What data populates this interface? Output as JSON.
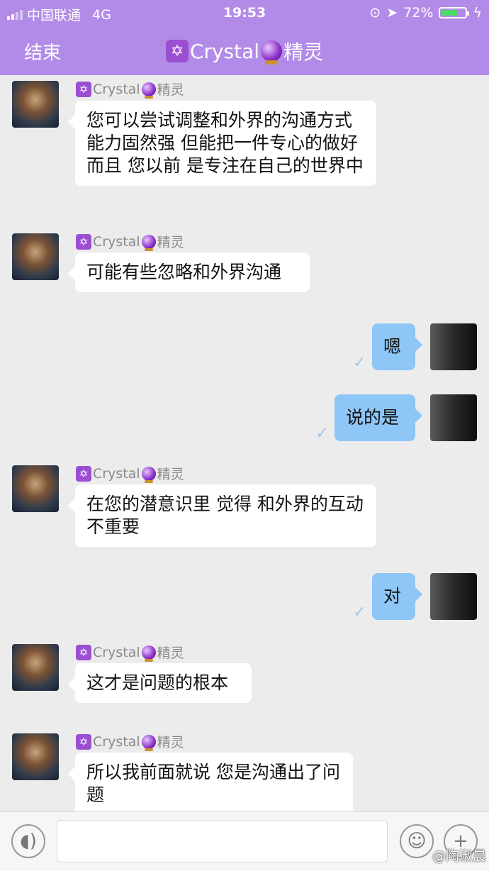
{
  "status": {
    "carrier": "中国联通",
    "network": "4G",
    "time": "19:53",
    "battery": "72%",
    "battery_level": 0.72
  },
  "nav": {
    "back_label": "结束",
    "title_name": "Crystal",
    "title_suffix": "精灵"
  },
  "messages": [
    {
      "from": "bot",
      "sender_name": "Crystal",
      "sender_suffix": "精灵",
      "text": "您可以尝试调整和外界的沟通方式 能力固然强 但能把一件专心的做好 而且 您以前 是专注在自己的世界中"
    },
    {
      "from": "bot",
      "sender_name": "Crystal",
      "sender_suffix": "精灵",
      "text": "可能有些忽略和外界沟通"
    },
    {
      "from": "me",
      "text": "嗯"
    },
    {
      "from": "me",
      "text": "说的是"
    },
    {
      "from": "bot",
      "sender_name": "Crystal",
      "sender_suffix": "精灵",
      "text": "在您的潜意识里 觉得 和外界的互动不重要"
    },
    {
      "from": "me",
      "text": "对"
    },
    {
      "from": "bot",
      "sender_name": "Crystal",
      "sender_suffix": "精灵",
      "text": "这才是问题的根本"
    },
    {
      "from": "bot",
      "sender_name": "Crystal",
      "sender_suffix": "精灵",
      "text": "所以我前面就说 您是沟通出了问题"
    }
  ],
  "input": {
    "placeholder": ""
  },
  "watermark": "@陶淑晨",
  "colors": {
    "header": "#b28be8",
    "my_bubble": "#8ec6f7",
    "bot_bubble": "#ffffff"
  }
}
